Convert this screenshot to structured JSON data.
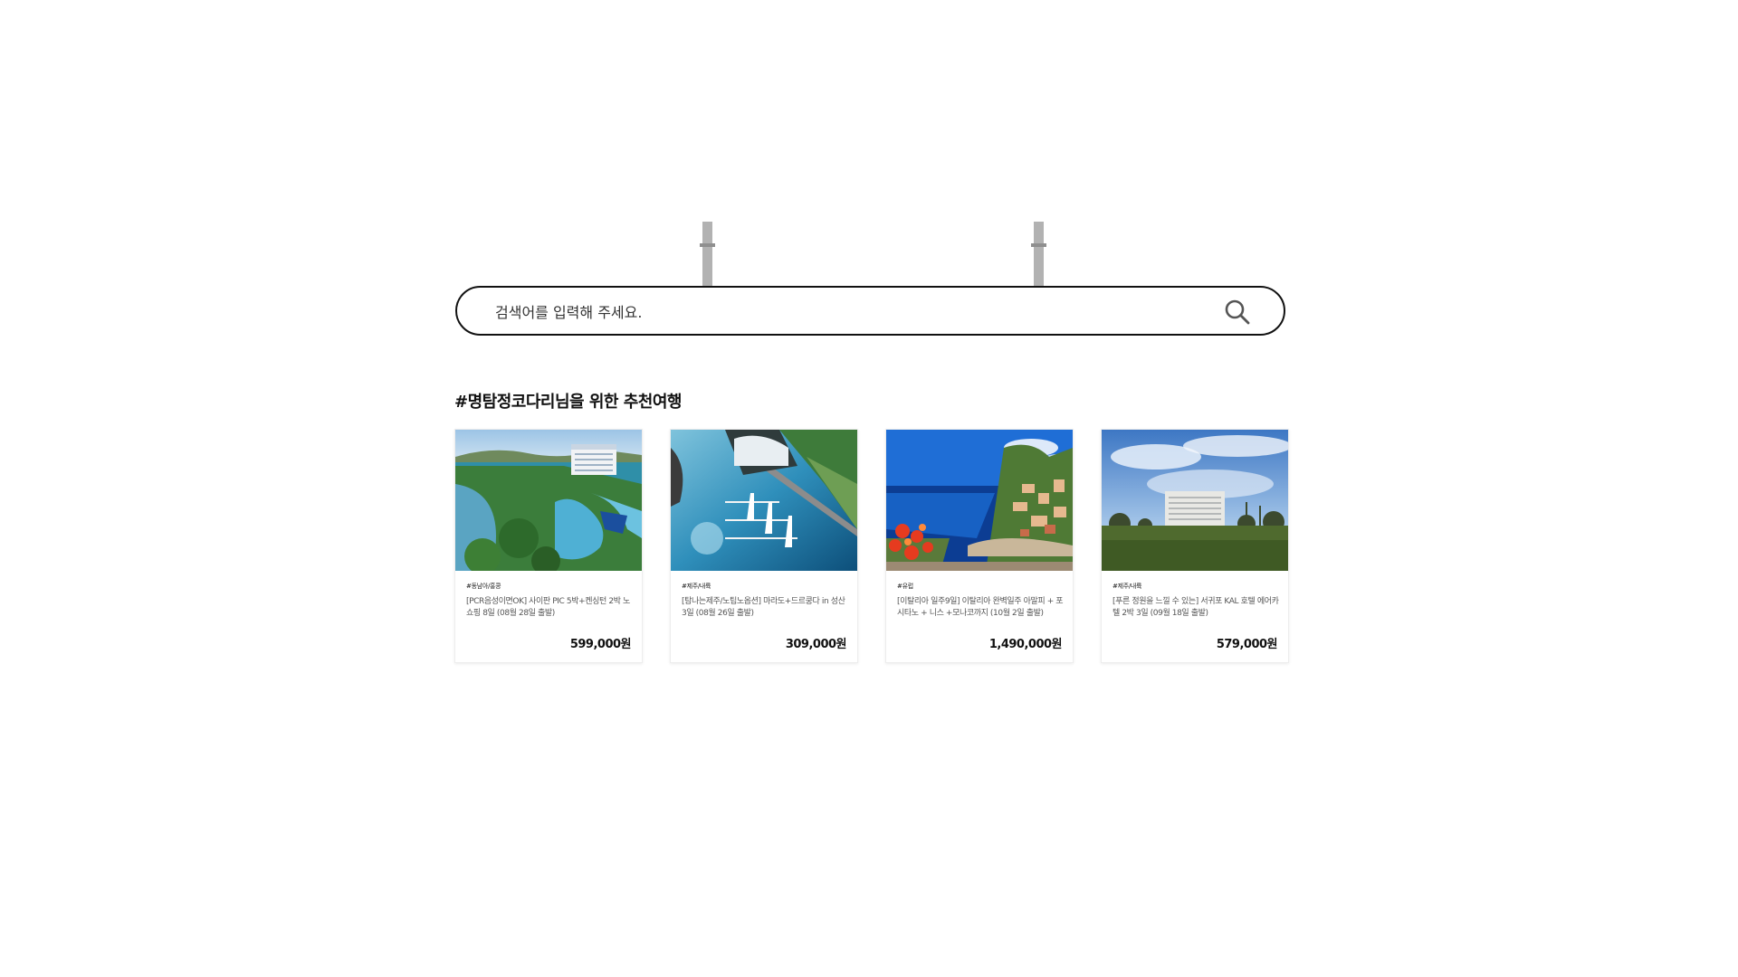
{
  "search": {
    "placeholder": "검색어를 입력해 주세요."
  },
  "recommend": {
    "title": "#명탐정코다리님을 위한 추천여행",
    "cards": [
      {
        "tag": "#동남아/홍콩",
        "description": "[PCR음성이면OK] 사이판 PIC 5박+켄싱턴 2박 노쇼핑 8일 (08월 28일 출발)",
        "price": "599,000원"
      },
      {
        "tag": "#제주/내륙",
        "description": "[탐나는제주/노팁노옵션] 마라도+드르쿵다 in 성산 3일 (08월 26일 출발)",
        "price": "309,000원"
      },
      {
        "tag": "#유럽",
        "description": "[이탈리아 일주9일] 이탈리아 완벽일주 아말피 + 포시타노 + 니스 +모나코까지 (10월 2일 출발)",
        "price": "1,490,000원"
      },
      {
        "tag": "#제주/내륙",
        "description": "[푸른 정원을 느낄 수 있는] 서귀포 KAL 호텔 에어카텔 2박 3일 (09월 18일 출발)",
        "price": "579,000원"
      }
    ]
  },
  "icons": {
    "search": "search-icon"
  },
  "colors": {
    "text": "#111111",
    "border": "#111111",
    "hanger": "#b2b2b2"
  }
}
